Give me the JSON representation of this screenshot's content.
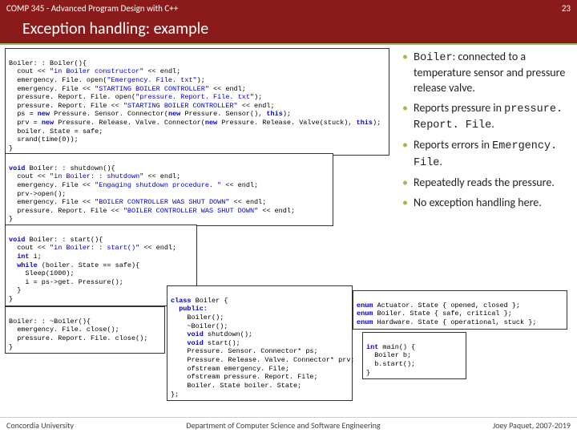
{
  "header": {
    "course": "COMP 345 - Advanced Program Design with C++",
    "page_num": "23"
  },
  "title": "Exception handling: example",
  "bullets": [
    {
      "pre": "",
      "mono": "Boiler",
      "post": ": connected to a temperature sensor and pressure release valve."
    },
    {
      "pre": "Reports pressure in ",
      "mono": "pressure. Report. File",
      "post": "."
    },
    {
      "pre": "Reports errors in ",
      "mono": "Emergency. File",
      "post": "."
    },
    {
      "pre": "Repeatedly reads the pressure.",
      "mono": "",
      "post": ""
    },
    {
      "pre": "No exception handling here.",
      "mono": "",
      "post": ""
    }
  ],
  "code": {
    "c1_l1": "Boiler: : Boiler(){",
    "c1_l2": "  cout << ",
    "c1_l2s": "\"in Boiler constructor\"",
    "c1_l2e": " << endl;",
    "c1_l3": "  emergency. File. open(",
    "c1_l3s": "\"Emergency. File. txt\"",
    "c1_l3e": ");",
    "c1_l4": "  emergency. File << ",
    "c1_l4s": "\"STARTING BOILER CONTROLLER\"",
    "c1_l4e": " << endl;",
    "c1_l5": "  pressure. Report. File. open(",
    "c1_l5s": "\"pressure. Report. File. txt\"",
    "c1_l5e": ");",
    "c1_l6": "  pressure. Report. File << ",
    "c1_l6s": "\"STARTING BOILER CONTROLLER\"",
    "c1_l6e": " << endl;",
    "c1_l7a": "  ps = ",
    "c1_l7k": "new",
    "c1_l7b": " Pressure. Sensor. Connector(",
    "c1_l7k2": "new",
    "c1_l7c": " Pressure. Sensor(), ",
    "c1_l7k3": "this",
    "c1_l7d": ");",
    "c1_l8a": "  prv = ",
    "c1_l8k": "new",
    "c1_l8b": " Pressure. Release. Valve. Connector(",
    "c1_l8k2": "new",
    "c1_l8c": " Pressure. Release. Valve(stuck), ",
    "c1_l8k3": "this",
    "c1_l8d": ");",
    "c1_l9": "  boiler. State = safe;",
    "c1_l10": "  srand(time(0));",
    "c1_l11": "}",
    "c2_l1a": "void",
    "c2_l1b": " Boiler: : shutdown(){",
    "c2_l2": "  cout << ",
    "c2_l2s": "\"in Boiler: : shutdown\"",
    "c2_l2e": " << endl;",
    "c2_l3": "  emergency. File << ",
    "c2_l3s": "\"Engaging shutdown procedure. \"",
    "c2_l3e": " << endl;",
    "c2_l4": "  prv->open();",
    "c2_l5": "  emergency. File << ",
    "c2_l5s": "\"BOILER CONTROLLER WAS SHUT DOWN\"",
    "c2_l5e": " << endl;",
    "c2_l6": "  pressure. Report. File << ",
    "c2_l6s": "\"BOILER CONTROLLER WAS SHUT DOWN\"",
    "c2_l6e": " << endl;",
    "c2_l7": "}",
    "c3_l1a": "void",
    "c3_l1b": " Boiler: : start(){",
    "c3_l2": "  cout << ",
    "c3_l2s": "\"in Boiler: : start()\"",
    "c3_l2e": " << endl;",
    "c3_l3a": "  ",
    "c3_l3k": "int",
    "c3_l3b": " i;",
    "c3_l4a": "  ",
    "c3_l4k": "while",
    "c3_l4b": " (boiler. State == safe){",
    "c3_l5": "    Sleep(1000);",
    "c3_l6": "    i = ps->get. Pressure();",
    "c3_l7": "  }",
    "c3_l8": "}",
    "c4_l1": "Boiler: : ~Boiler(){",
    "c4_l2": "  emergency. File. close();",
    "c4_l3": "  pressure. Report. File. close();",
    "c4_l4": "}",
    "c5_l1a": "class",
    "c5_l1b": " Boiler {",
    "c5_l2": "  public:",
    "c5_l3": "    Boiler();",
    "c5_l4": "    ~Boiler();",
    "c5_l5a": "    ",
    "c5_l5k": "void",
    "c5_l5b": " shutdown();",
    "c5_l6a": "    ",
    "c5_l6k": "void",
    "c5_l6b": " start();",
    "c5_l7": "    Pressure. Sensor. Connector* ps;",
    "c5_l8": "    Pressure. Release. Valve. Connector* prv;",
    "c5_l9": "    ofstream emergency. File;",
    "c5_l10": "    ofstream pressure. Report. File;",
    "c5_l11": "    Boiler. State boiler. State;",
    "c5_l12": "};",
    "c6_l1a": "enum",
    "c6_l1b": " Actuator. State { opened, closed };",
    "c6_l2a": "enum",
    "c6_l2b": " Boiler. State { safe, critical };",
    "c6_l3a": "enum",
    "c6_l3b": " Hardware. State { operational, stuck };",
    "c7_l1a": "int",
    "c7_l1b": " main() {",
    "c7_l2": "  Boiler b;",
    "c7_l3": "  b.start();",
    "c7_l4": "}"
  },
  "footer": {
    "left": "Concordia University",
    "center": "Department of Computer Science and Software Engineering",
    "right": "Joey Paquet, 2007-2019"
  }
}
